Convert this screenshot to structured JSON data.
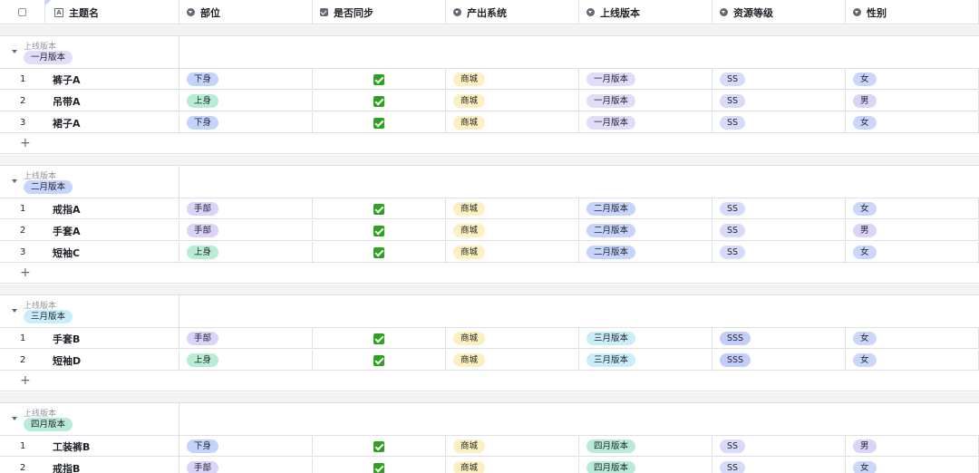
{
  "columns": [
    {
      "label": "主题名",
      "icon": "text-field-icon"
    },
    {
      "label": "部位",
      "icon": "single-select-icon"
    },
    {
      "label": "是否同步",
      "icon": "checkbox-field-icon"
    },
    {
      "label": "产出系统",
      "icon": "single-select-icon"
    },
    {
      "label": "上线版本",
      "icon": "single-select-icon"
    },
    {
      "label": "资源等级",
      "icon": "single-select-icon"
    },
    {
      "label": "性别",
      "icon": "single-select-icon"
    }
  ],
  "text_icon_glyph": "A",
  "group_field_label": "上线版本",
  "add_symbol": "+",
  "groups": [
    {
      "version": "一月版本",
      "rows": [
        {
          "index": "1",
          "name": "裤子A",
          "part": "下身",
          "synced": true,
          "system": "商城",
          "version": "一月版本",
          "level": "SS",
          "gender": "女"
        },
        {
          "index": "2",
          "name": "吊带A",
          "part": "上身",
          "synced": true,
          "system": "商城",
          "version": "一月版本",
          "level": "SS",
          "gender": "男"
        },
        {
          "index": "3",
          "name": "裙子A",
          "part": "下身",
          "synced": true,
          "system": "商城",
          "version": "一月版本",
          "level": "SS",
          "gender": "女"
        }
      ]
    },
    {
      "version": "二月版本",
      "rows": [
        {
          "index": "1",
          "name": "戒指A",
          "part": "手部",
          "synced": true,
          "system": "商城",
          "version": "二月版本",
          "level": "SS",
          "gender": "女"
        },
        {
          "index": "2",
          "name": "手套A",
          "part": "手部",
          "synced": true,
          "system": "商城",
          "version": "二月版本",
          "level": "SS",
          "gender": "男"
        },
        {
          "index": "3",
          "name": "短袖C",
          "part": "上身",
          "synced": true,
          "system": "商城",
          "version": "二月版本",
          "level": "SS",
          "gender": "女"
        }
      ]
    },
    {
      "version": "三月版本",
      "rows": [
        {
          "index": "1",
          "name": "手套B",
          "part": "手部",
          "synced": true,
          "system": "商城",
          "version": "三月版本",
          "level": "SSS",
          "gender": "女"
        },
        {
          "index": "2",
          "name": "短袖D",
          "part": "上身",
          "synced": true,
          "system": "商城",
          "version": "三月版本",
          "level": "SSS",
          "gender": "女"
        }
      ]
    },
    {
      "version": "四月版本",
      "rows": [
        {
          "index": "1",
          "name": "工装裤B",
          "part": "下身",
          "synced": true,
          "system": "商城",
          "version": "四月版本",
          "level": "SS",
          "gender": "男"
        },
        {
          "index": "2",
          "name": "戒指B",
          "part": "手部",
          "synced": true,
          "system": "商城",
          "version": "四月版本",
          "level": "SS",
          "gender": "女"
        }
      ]
    }
  ],
  "colors": {
    "下身": "#c4d3fb",
    "上身": "#b7ecd5",
    "手部": "#dcd3fa",
    "商城": "#fcefc0",
    "一月版本": "#e1dcfa",
    "二月版本": "#c7d4fc",
    "三月版本": "#c9eefa",
    "四月版本": "#b9ebdb",
    "SS": "#d8dafa",
    "SSS": "#c2cdfb",
    "女": "#cad7fb",
    "男": "#ddd3f9",
    "check": "#2ea121"
  }
}
